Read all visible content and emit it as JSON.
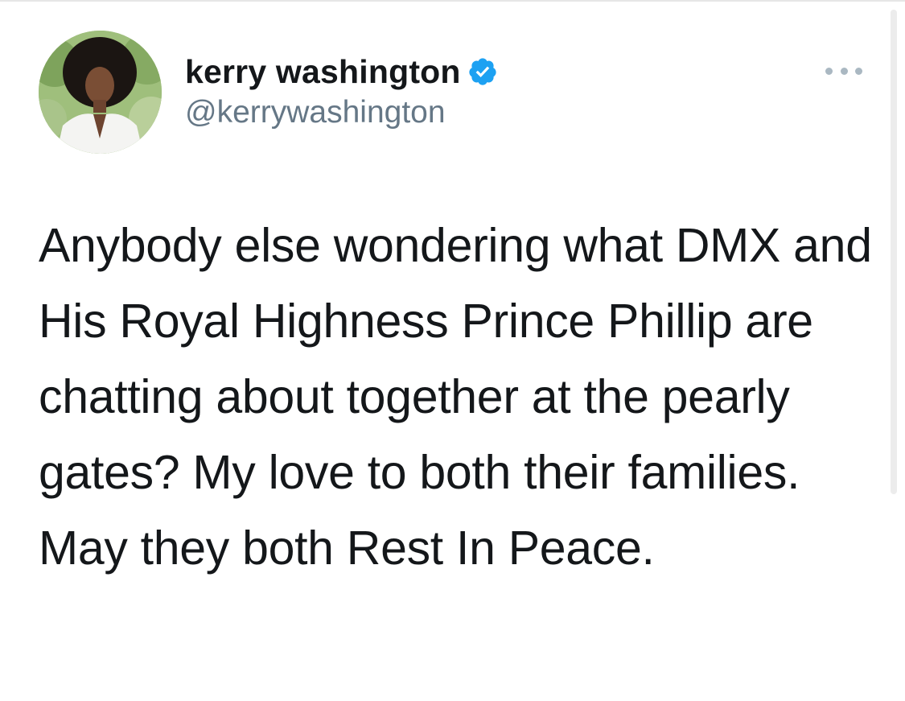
{
  "author": {
    "display_name": "kerry washington",
    "handle": "@kerrywashington",
    "verified_icon": "verified-badge-icon",
    "verified_color": "#1da1f2",
    "avatar": "profile-photo"
  },
  "actions": {
    "more_icon": "more-options-icon"
  },
  "tweet": {
    "text": "Anybody else wondering what DMX and His Royal Highness Prince Phillip are chatting about together at the pearly gates? My love to both their families. May they both Rest In Peace."
  },
  "colors": {
    "text": "#14171a",
    "secondary": "#657786",
    "icon_gray": "#aab8c2"
  }
}
